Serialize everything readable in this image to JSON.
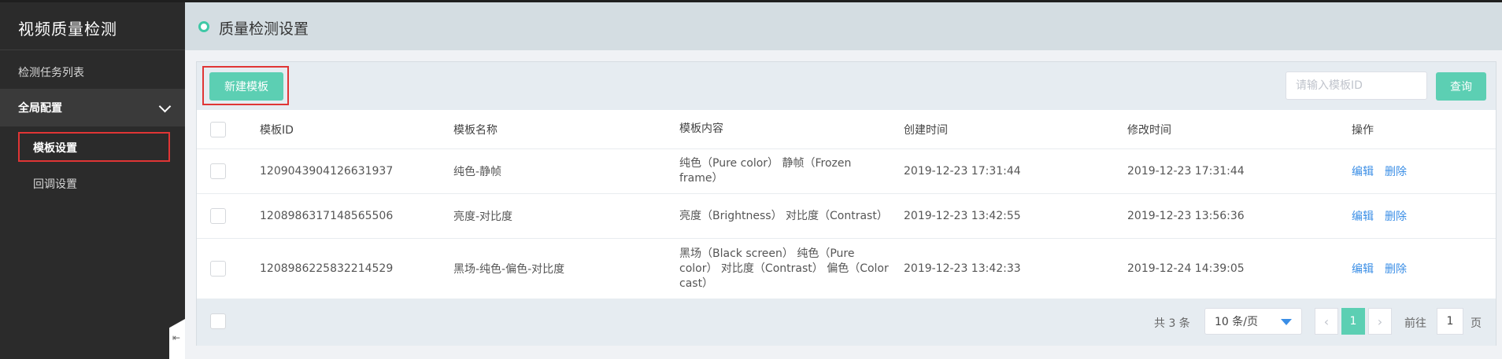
{
  "sidebar": {
    "app_title": "视频质量检测",
    "items": [
      {
        "label": "检测任务列表"
      },
      {
        "label": "全局配置"
      }
    ],
    "sub_items": [
      {
        "label": "模板设置"
      },
      {
        "label": "回调设置"
      }
    ],
    "collapse_icon": "⇤"
  },
  "header": {
    "title": "质量检测设置"
  },
  "toolbar": {
    "new_label": "新建模板",
    "search_placeholder": "请输入模板ID",
    "search_value": "",
    "query_label": "查询"
  },
  "table": {
    "columns": [
      "模板ID",
      "模板名称",
      "模板内容",
      "创建时间",
      "修改时间",
      "操作"
    ],
    "rows": [
      {
        "id": "1209043904126631937",
        "name": "纯色-静帧",
        "content": "纯色（Pure color） 静帧（Frozen frame）",
        "created": "2019-12-23 17:31:44",
        "modified": "2019-12-23 17:31:44",
        "edit": "编辑",
        "delete": "删除"
      },
      {
        "id": "1208986317148565506",
        "name": "亮度-对比度",
        "content": "亮度（Brightness） 对比度（Contrast）",
        "created": "2019-12-23 13:42:55",
        "modified": "2019-12-23 13:56:36",
        "edit": "编辑",
        "delete": "删除"
      },
      {
        "id": "1208986225832214529",
        "name": "黑场-纯色-偏色-对比度",
        "content": "黑场（Black screen） 纯色（Pure color） 对比度（Contrast） 偏色（Color cast）",
        "created": "2019-12-23 13:42:33",
        "modified": "2019-12-24 14:39:05",
        "edit": "编辑",
        "delete": "删除"
      }
    ]
  },
  "pagination": {
    "total_text": "共 3 条",
    "page_size": "10 条/页",
    "prev": "‹",
    "current_page": "1",
    "next": "›",
    "goto_label": "前往",
    "goto_value": "1",
    "page_unit": "页"
  },
  "colors": {
    "accent": "#5ccfb3",
    "highlight": "#e03535",
    "link": "#3a8ee6",
    "sidebar_bg": "#2b2b2b"
  }
}
